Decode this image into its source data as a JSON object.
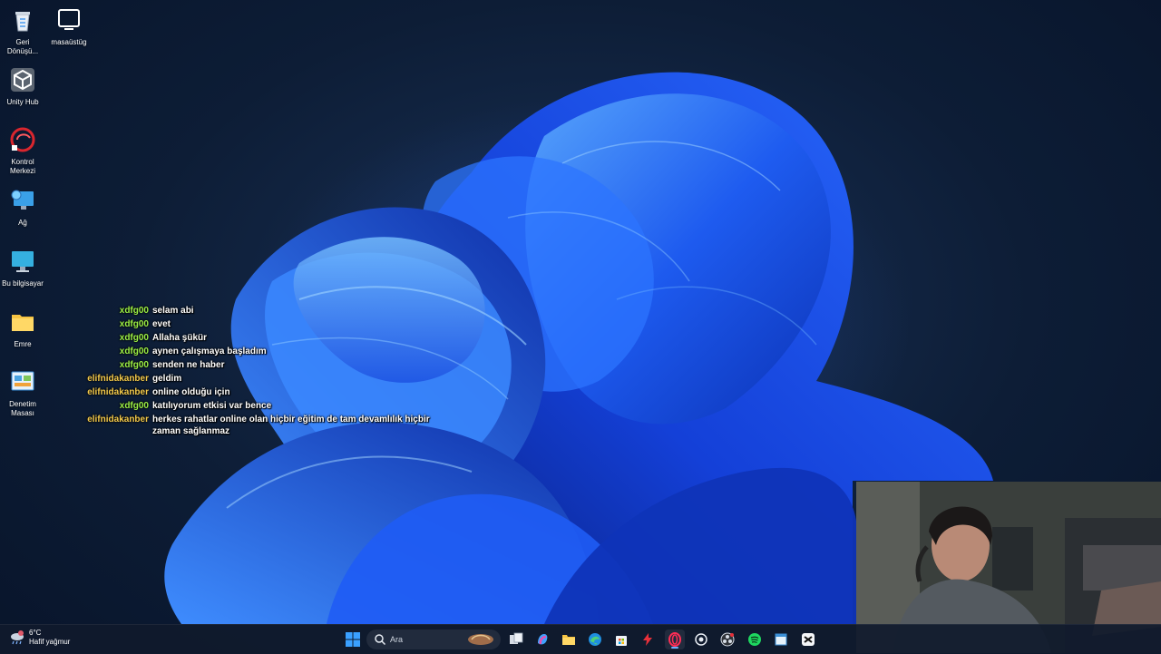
{
  "desktop": {
    "icons": [
      {
        "label": "Geri Dönüşü...",
        "icon": "recycle-bin-icon"
      },
      {
        "label": "masaüstüg",
        "icon": "laptop-outline-icon"
      },
      {
        "label": "Unity Hub",
        "icon": "unity-hub-icon"
      },
      {
        "label": "Kontrol Merkezi",
        "icon": "control-center-icon"
      },
      {
        "label": "Ağ",
        "icon": "network-icon"
      },
      {
        "label": "Bu bilgisayar",
        "icon": "this-pc-icon"
      },
      {
        "label": "Emre",
        "icon": "folder-icon"
      },
      {
        "label": "Denetim Masası",
        "icon": "control-panel-icon"
      }
    ]
  },
  "chat": {
    "colors": {
      "xdfg00": "#9cf046",
      "elifnidakanber": "#f2c94c"
    },
    "messages": [
      {
        "user": "xdfg00",
        "text": "selam abi"
      },
      {
        "user": "xdfg00",
        "text": "evet"
      },
      {
        "user": "xdfg00",
        "text": "Allaha şükür"
      },
      {
        "user": "xdfg00",
        "text": "aynen çalışmaya başladım"
      },
      {
        "user": "xdfg00",
        "text": "senden ne haber"
      },
      {
        "user": "elifnidakanber",
        "text": "geldim"
      },
      {
        "user": "elifnidakanber",
        "text": "online olduğu için"
      },
      {
        "user": "xdfg00",
        "text": "katılıyorum etkisi var bence"
      },
      {
        "user": "elifnidakanber",
        "text": "herkes rahatlar online olan hiçbir eğitim de tam devamlılık hiçbir zaman sağlanmaz"
      }
    ]
  },
  "taskbar": {
    "weather": {
      "temp": "6°C",
      "condition": "Hafif yağmur",
      "icon": "weather-rain-icon"
    },
    "search": {
      "placeholder": "Ara"
    },
    "apps": [
      {
        "name": "start-button",
        "icon": "windows-logo-icon"
      },
      {
        "name": "task-view-button",
        "icon": "task-view-icon"
      },
      {
        "name": "copilot-button",
        "icon": "copilot-icon"
      },
      {
        "name": "file-explorer-button",
        "icon": "folder-icon"
      },
      {
        "name": "edge-button",
        "icon": "edge-icon"
      },
      {
        "name": "store-button",
        "icon": "store-icon"
      },
      {
        "name": "app-red-bolt-button",
        "icon": "bolt-icon"
      },
      {
        "name": "opera-gx-button",
        "icon": "opera-gx-icon"
      },
      {
        "name": "steam-button",
        "icon": "steam-icon"
      },
      {
        "name": "obs-button",
        "icon": "obs-icon"
      },
      {
        "name": "spotify-button",
        "icon": "spotify-icon"
      },
      {
        "name": "app-window-button",
        "icon": "window-icon"
      },
      {
        "name": "capcut-button",
        "icon": "capcut-icon"
      }
    ]
  }
}
